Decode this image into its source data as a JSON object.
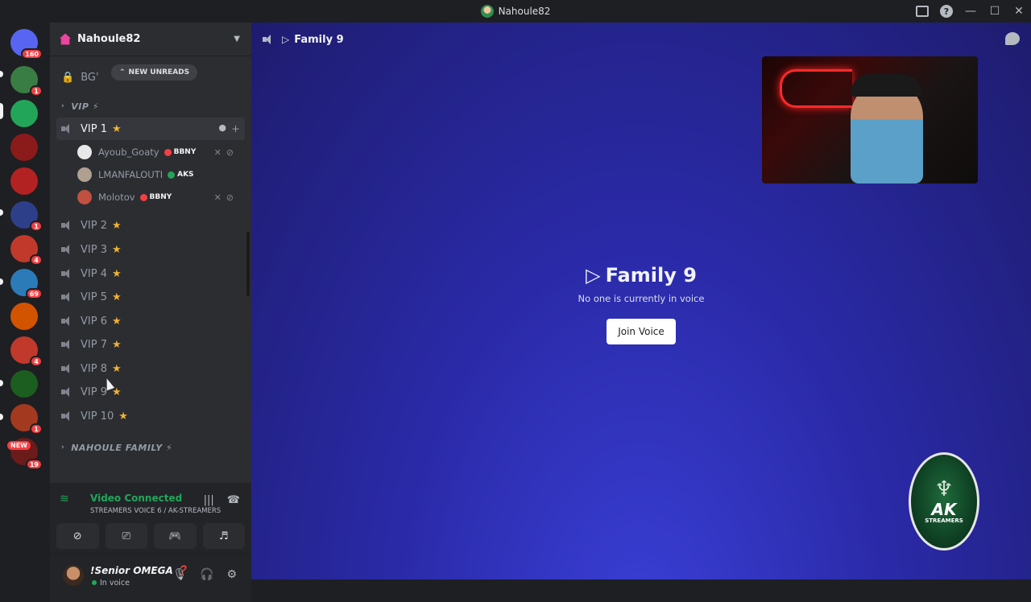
{
  "titlebar": {
    "title": "Nahoule82",
    "window_controls": [
      "minimize",
      "maximize",
      "close"
    ]
  },
  "guilds": [
    {
      "badge": "160",
      "icon": "discord-home-icon",
      "color": "#5865f2"
    },
    {
      "badge": "1",
      "color": "#3a7d44"
    },
    {
      "badge": "",
      "color": "#23a559"
    },
    {
      "badge": "",
      "color": "#8b1a1a"
    },
    {
      "badge": "",
      "color": "#b22222"
    },
    {
      "badge": "1",
      "color": "#2e3f8a"
    },
    {
      "badge": "4",
      "color": "#c0392b"
    },
    {
      "badge": "69",
      "color": "#2b7bb9"
    },
    {
      "badge": "",
      "color": "#d35400"
    },
    {
      "badge": "4",
      "color": "#c0392b"
    },
    {
      "badge": "",
      "color": "#1b5e20"
    },
    {
      "badge": "1",
      "color": "#a33a1f"
    },
    {
      "badge": "19",
      "label": "NEW",
      "color": "#6c1b1b"
    }
  ],
  "sidebar": {
    "server_name": "Nahoule82",
    "new_unreads_label": "NEW UNREADS",
    "locked_channel": "BG'",
    "category_vip": "VIP ⚡",
    "category_family": "NAHOULE FAMILY ⚡",
    "channels": [
      {
        "name": "VIP 1",
        "star": "★",
        "active": true
      },
      {
        "name": "VIP 2",
        "star": "★"
      },
      {
        "name": "VIP 3",
        "star": "★"
      },
      {
        "name": "VIP 4",
        "star": "★"
      },
      {
        "name": "VIP 5",
        "star": "★"
      },
      {
        "name": "VIP 6",
        "star": "★"
      },
      {
        "name": "VIP 7",
        "star": "★"
      },
      {
        "name": "VIP 8",
        "star": "★"
      },
      {
        "name": "VIP 9",
        "star": "★"
      },
      {
        "name": "VIP 10",
        "star": "★"
      }
    ],
    "members": [
      {
        "name": "Ayoub_Goaty",
        "tag": "BBNY",
        "tag_color": "#f23f43"
      },
      {
        "name": "LMANFALOUTI",
        "tag": "AKS",
        "tag_color": "#23a55a"
      },
      {
        "name": "Molotov",
        "tag": "BBNY",
        "tag_color": "#f23f43"
      }
    ]
  },
  "voice": {
    "title": "Video Connected",
    "subtitle": "STREAMERS VOICE 6 / AK-STREAMERS"
  },
  "user": {
    "name": "!Senior OMEGA ❓",
    "status": "In voice"
  },
  "main": {
    "channel_title": "Family 9",
    "center_title": "Family 9",
    "empty_text": "No one is currently in voice",
    "join_label": "Join Voice",
    "logo_ak": "AK",
    "logo_sub": "STREAMERS"
  },
  "colors": {
    "accent": "#5865f2",
    "main_bg": "#2a2aa8",
    "green": "#23a55a",
    "star": "#f0b232"
  }
}
